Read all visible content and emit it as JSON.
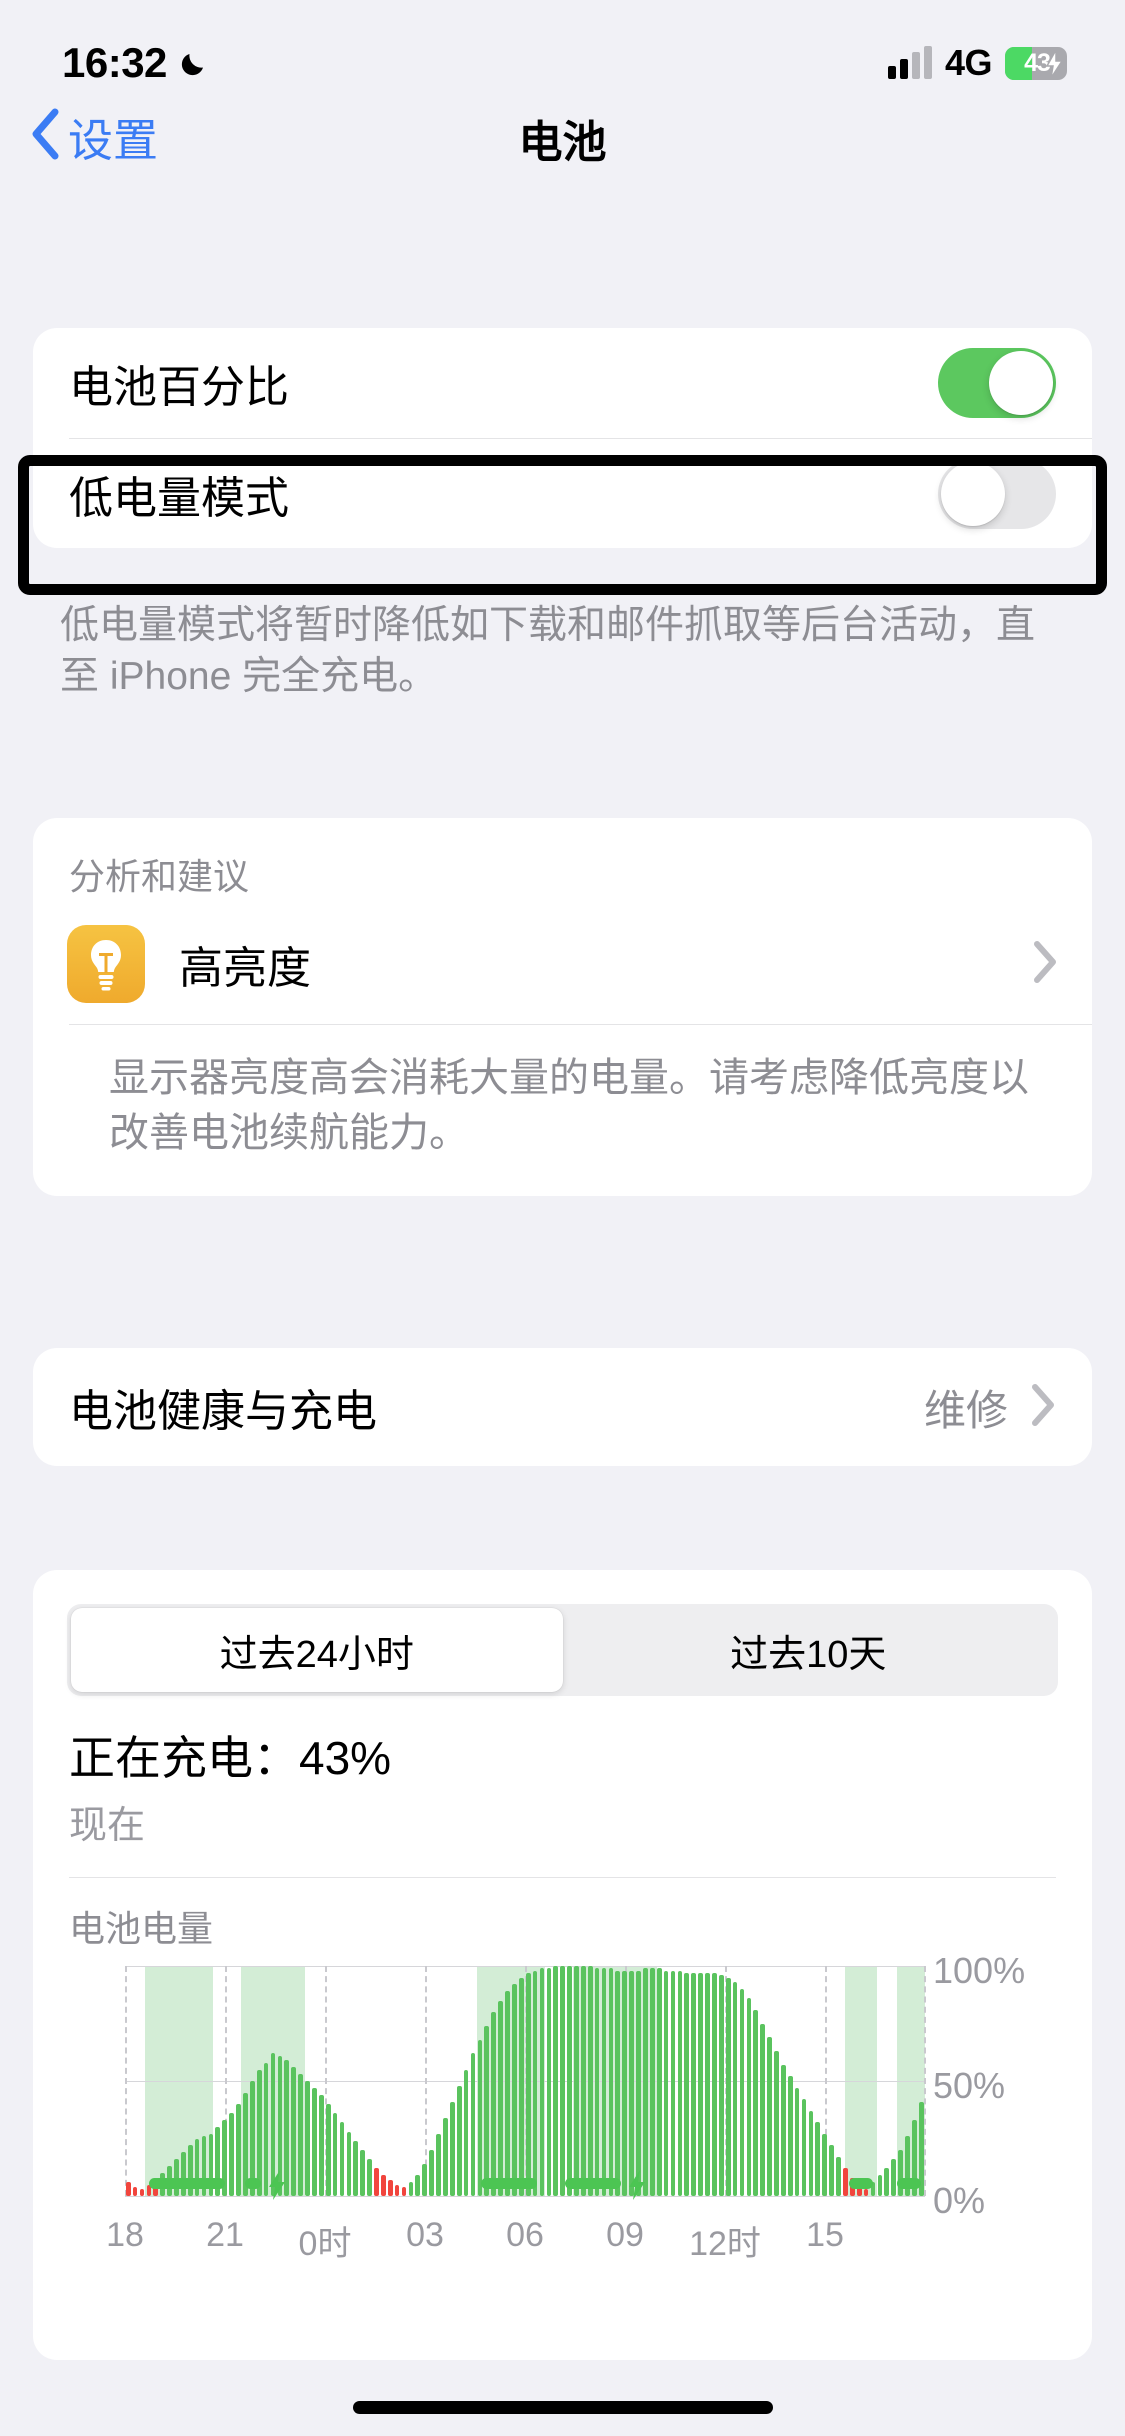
{
  "status_bar": {
    "time": "16:32",
    "dnd_icon": "crescent-moon-icon",
    "signal_icon": "cellular-bars-icon",
    "network": "4G",
    "battery_percent": "43",
    "battery_level": 43,
    "battery_charging": true,
    "battery_fill_color": "#4cd964"
  },
  "nav": {
    "back_label": "设置",
    "back_icon": "chevron-left-icon",
    "title": "电池",
    "accent_color": "#3b7cf4"
  },
  "toggles_card": {
    "rows": [
      {
        "label": "电池百分比",
        "state": "on"
      },
      {
        "label": "低电量模式",
        "state": "off"
      }
    ],
    "footer": "低电量模式将暂时降低如下载和邮件抓取等后台活动，直至 iPhone 完全充电。",
    "on_color": "#5cc85f",
    "off_color": "#e6e6e8"
  },
  "highlight": {
    "target": "低电量模式",
    "border_color": "#000000"
  },
  "analytics_card": {
    "title": "分析和建议",
    "suggestion": {
      "icon": "lightbulb-icon",
      "icon_color": "#f2b431",
      "label": "高亮度",
      "chevron": "chevron-right-icon",
      "description": "显示器亮度高会消耗大量的电量。请考虑降低亮度以改善电池续航能力。"
    }
  },
  "battery_health_card": {
    "label": "电池健康与充电",
    "value": "维修",
    "chevron": "chevron-right-icon"
  },
  "usage_card": {
    "segments": [
      {
        "label": "过去24小时",
        "selected": true
      },
      {
        "label": "过去10天",
        "selected": false
      }
    ],
    "charge_status": "正在充电：43%",
    "charge_time": "现在"
  },
  "chart_data": {
    "type": "bar",
    "title": "电池电量",
    "xlabel": "",
    "ylabel": "",
    "ylim": [
      0,
      100
    ],
    "ytick_labels": [
      "100%",
      "50%",
      "0%"
    ],
    "yticks": [
      100,
      50,
      0
    ],
    "grid": true,
    "x_tick_labels": [
      "18",
      "21",
      "0时",
      "03",
      "06",
      "09",
      "12时",
      "15"
    ],
    "x_tick_positions": [
      0,
      12.5,
      25,
      37.5,
      50,
      62.5,
      75,
      87.5
    ],
    "series": [
      {
        "name": "电池电量",
        "color": "#5ac35e",
        "low_color": "#f1453d",
        "values": [
          6,
          4,
          3,
          5,
          8,
          10,
          13,
          16,
          19,
          22,
          25,
          26,
          27,
          30,
          33,
          36,
          40,
          45,
          50,
          55,
          58,
          62,
          61,
          59,
          56,
          53,
          50,
          47,
          44,
          40,
          36,
          32,
          28,
          24,
          20,
          16,
          12,
          9,
          7,
          5,
          4,
          6,
          9,
          14,
          20,
          27,
          34,
          41,
          48,
          55,
          62,
          68,
          74,
          80,
          85,
          89,
          92,
          95,
          97,
          98,
          99,
          99,
          100,
          100,
          100,
          100,
          100,
          100,
          99,
          99,
          99,
          98,
          98,
          98,
          98,
          99,
          99,
          99,
          98,
          98,
          98,
          97,
          97,
          97,
          97,
          97,
          96,
          95,
          93,
          90,
          86,
          81,
          75,
          69,
          63,
          57,
          52,
          47,
          42,
          37,
          32,
          27,
          22,
          17,
          12,
          8,
          5,
          3,
          6,
          9,
          12,
          16,
          20,
          26,
          33,
          41
        ],
        "low_battery_indices": [
          0,
          1,
          2,
          3,
          4,
          36,
          37,
          38,
          39,
          40,
          104,
          105,
          106,
          107
        ]
      }
    ],
    "charging_bands": [
      {
        "start": 2.5,
        "end": 11.0
      },
      {
        "start": 14.5,
        "end": 22.5
      },
      {
        "start": 44.0,
        "end": 52.5
      },
      {
        "start": 56.0,
        "end": 66.5
      },
      {
        "start": 90.0,
        "end": 94.0
      },
      {
        "start": 96.5,
        "end": 100.0
      }
    ],
    "charge_pills": [
      {
        "start": 3.0,
        "end": 12.5,
        "bolt": false
      },
      {
        "start": 15.0,
        "end": 17.0,
        "bolt": true
      },
      {
        "start": 44.5,
        "end": 51.5,
        "bolt": false
      },
      {
        "start": 55.0,
        "end": 62.0,
        "bolt": true
      },
      {
        "start": 90.5,
        "end": 93.5,
        "bolt": false
      },
      {
        "start": 96.5,
        "end": 99.5,
        "bolt": false
      }
    ],
    "band_color": "#d3edd6",
    "pill_color": "#4cc553"
  }
}
